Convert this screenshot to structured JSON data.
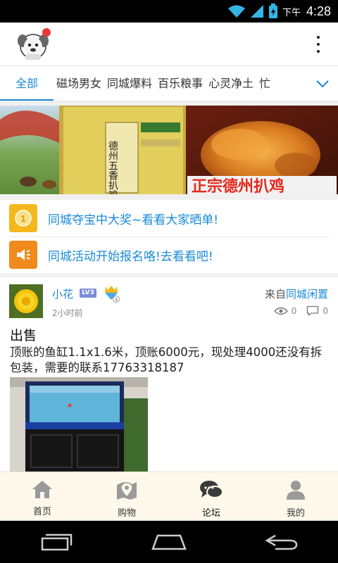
{
  "status_bar": {
    "ampm": "下午",
    "time": "4:28"
  },
  "tabs": {
    "items": [
      "全部",
      "磁场男女",
      "同城爆料",
      "百乐粮事",
      "心灵净土",
      "忙"
    ],
    "active_index": 0
  },
  "banner": {
    "product_text": "德州五香扒鸡",
    "slogan": "正宗德州扒鸡"
  },
  "notices": [
    {
      "icon": "coin-icon",
      "text": "同城夺宝中大奖~看看大家晒单!"
    },
    {
      "icon": "speaker-icon",
      "text": "同城活动开始报名咯!去看看吧!"
    }
  ],
  "post": {
    "author": "小花",
    "level": "LV3",
    "badge_level": "3",
    "time": "2小时前",
    "from_prefix": "来自",
    "from_source": "同城闲置",
    "views": "0",
    "comments": "0",
    "title": "出售",
    "body": "顶账的鱼缸1.1x1.6米，顶账6000元，现处理4000还没有拆包装，需要的联系17763318187"
  },
  "bottom_nav": [
    {
      "label": "首页",
      "icon": "home-icon"
    },
    {
      "label": "购物",
      "icon": "location-pin-icon"
    },
    {
      "label": "论坛",
      "icon": "chat-bubbles-icon"
    },
    {
      "label": "我的",
      "icon": "person-icon"
    }
  ],
  "colors": {
    "accent": "#1a8ad8",
    "bottom_nav_bg": "#fdf8ea",
    "notice_icon_bg": "#f5b81c",
    "speaker_icon_bg": "#f08a1c"
  }
}
